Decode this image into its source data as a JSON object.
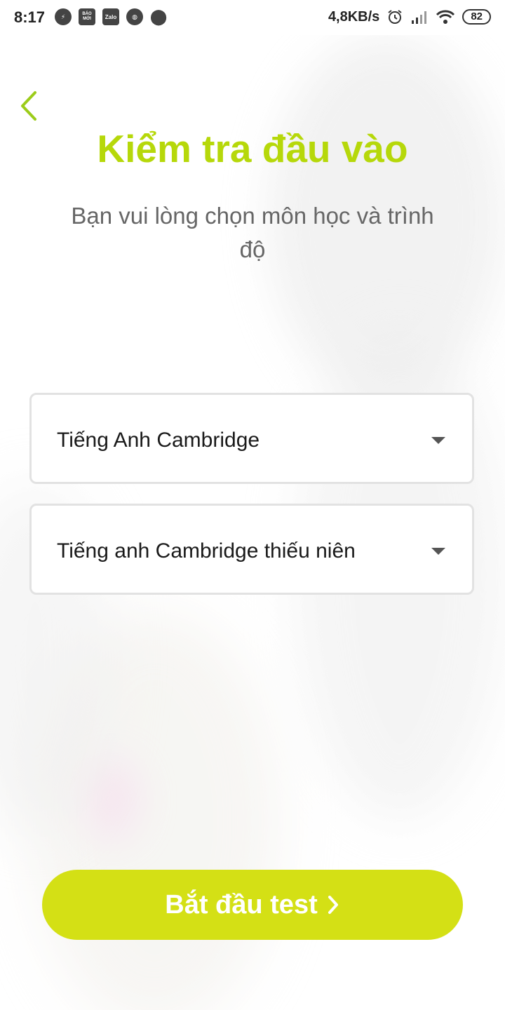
{
  "status_bar": {
    "time": "8:17",
    "left_icons": [
      "bolt-icon",
      "bao-moi-icon",
      "zalo-icon",
      "globe-icon",
      "location-icon"
    ],
    "bao_moi_text": "BÁO MỚI",
    "zalo_text": "Zalo",
    "net_speed": "4,8KB/s",
    "battery": "82"
  },
  "page": {
    "title": "Kiểm tra đầu vào",
    "subtitle": "Bạn vui lòng chọn môn học và trình độ",
    "accent_color": "#b6d80a"
  },
  "subject_select": {
    "selected": "Tiếng Anh Cambridge"
  },
  "level_select": {
    "selected": "Tiếng anh Cambridge thiếu niên"
  },
  "start_button": {
    "label": "Bắt đầu test",
    "color": "#d4e015"
  }
}
